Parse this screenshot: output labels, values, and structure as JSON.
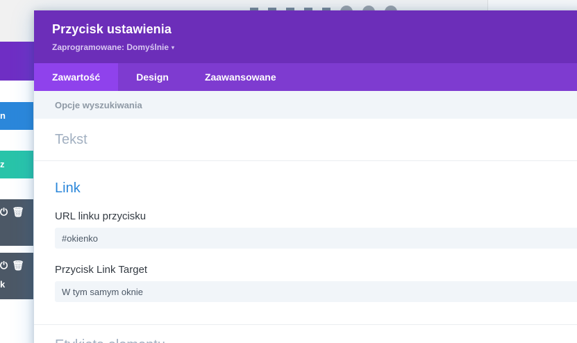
{
  "modal": {
    "title": "Przycisk ustawienia",
    "preset_label": "Zaprogramowane: Domyślnie",
    "preset_caret": "▾"
  },
  "tabs": [
    {
      "label": "Zawartość",
      "active": true
    },
    {
      "label": "Design",
      "active": false
    },
    {
      "label": "Zaawansowane",
      "active": false
    }
  ],
  "filter": {
    "label": "Opcje wyszukiwania"
  },
  "sections": {
    "text_title": "Tekst",
    "link": {
      "title": "Link",
      "url_label": "URL linku przycisku",
      "url_value": "#okienko",
      "target_label": "Przycisk Link Target",
      "target_value": "W tym samym oknie"
    },
    "next_title": "Etykieta elementu"
  },
  "background": {
    "blue_button_text": "n",
    "teal_button_text": "z",
    "dark_button2_text": "k",
    "power_icon": "⏻",
    "trash_icon": "🗑"
  },
  "colors": {
    "header": "#6c2eb9",
    "tabs": "#7e3bd0",
    "active_tab": "#8f42ec",
    "link_accent": "#2b87da"
  }
}
